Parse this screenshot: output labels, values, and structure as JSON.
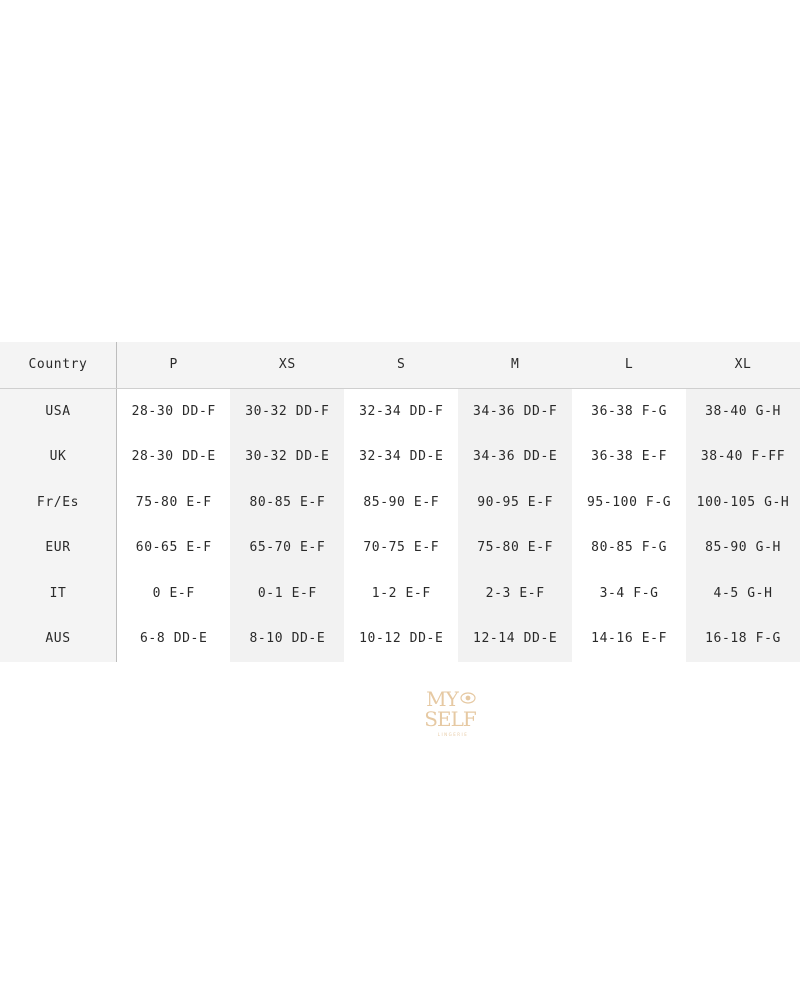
{
  "table": {
    "header": {
      "country": "Country",
      "sizes": [
        "P",
        "XS",
        "S",
        "M",
        "L",
        "XL"
      ]
    },
    "rows": [
      {
        "country": "USA",
        "values": [
          "28-30 DD-F",
          "30-32 DD-F",
          "32-34 DD-F",
          "34-36 DD-F",
          "36-38 F-G",
          "38-40 G-H"
        ]
      },
      {
        "country": "UK",
        "values": [
          "28-30 DD-E",
          "30-32 DD-E",
          "32-34 DD-E",
          "34-36 DD-E",
          "36-38 E-F",
          "38-40 F-FF"
        ]
      },
      {
        "country": "Fr/Es",
        "values": [
          "75-80 E-F",
          "80-85 E-F",
          "85-90 E-F",
          "90-95 E-F",
          "95-100 F-G",
          "100-105 G-H"
        ]
      },
      {
        "country": "EUR",
        "values": [
          "60-65 E-F",
          "65-70 E-F",
          "70-75 E-F",
          "75-80 E-F",
          "80-85 F-G",
          "85-90 G-H"
        ]
      },
      {
        "country": "IT",
        "values": [
          "0 E-F",
          "0-1 E-F",
          "1-2 E-F",
          "2-3 E-F",
          "3-4 F-G",
          "4-5 G-H"
        ]
      },
      {
        "country": "AUS",
        "values": [
          "6-8 DD-E",
          "8-10 DD-E",
          "10-12 DD-E",
          "12-14 DD-E",
          "14-16 E-F",
          "16-18 F-G"
        ]
      }
    ]
  },
  "logo": {
    "line1": "MY",
    "line2": "SELF",
    "tagline": "LINGERIE",
    "color": "#e6c9a3"
  }
}
